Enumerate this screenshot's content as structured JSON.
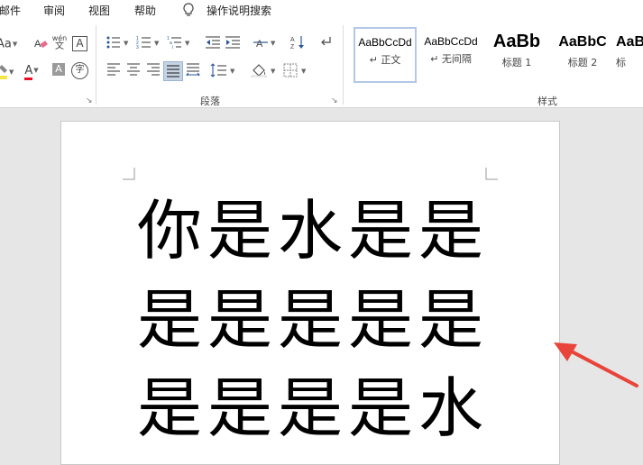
{
  "menu": {
    "items": [
      "邮件",
      "审阅",
      "视图",
      "帮助"
    ],
    "tell_me": "操作说明搜索"
  },
  "ribbon": {
    "font_group": {
      "font_size_icon": "Aa",
      "pinyin_top": "wén",
      "pinyin_bottom": "文",
      "char_border": "A",
      "font_color_letter": "A",
      "shading_letter": "A",
      "enclose_char": "字"
    },
    "paragraph_group": {
      "label": "段落"
    },
    "styles_group": {
      "label": "样式",
      "styles": [
        {
          "sample": "AaBbCcDd",
          "name": "↵ 正文"
        },
        {
          "sample": "AaBbCcDd",
          "name": "↵ 无间隔"
        },
        {
          "sample": "AaBb",
          "name": "标题 1"
        },
        {
          "sample": "AaBbC",
          "name": "标题 2"
        },
        {
          "sample": "AaB",
          "name": "标"
        }
      ]
    },
    "colors": {
      "highlight": "#f5e642",
      "font_color": "#e81123",
      "active": "#c5d3e5"
    }
  },
  "document": {
    "lines": [
      "你是水是是",
      "是是是是是",
      "是是是是水"
    ]
  },
  "annotation": {
    "arrow_color": "#e8443a"
  }
}
